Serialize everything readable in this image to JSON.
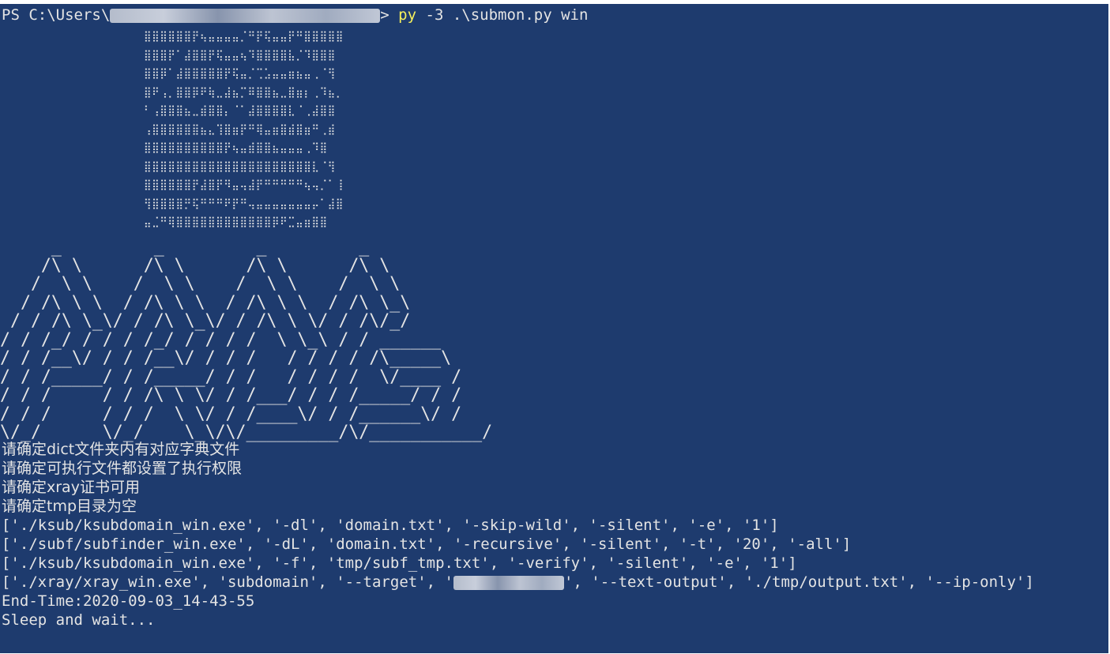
{
  "prompt": {
    "prefix": "PS C:\\Users\\",
    "suffix": "> ",
    "command_py": "py",
    "command_args": " -3 .\\submon.py win"
  },
  "braille_art": [
    "⣿⣿⣿⣿⣿⣿⡟⢦⣤⣤⣤⣤⡈⠛⡟⢯⣤⣤⡟⠛⣿⣿⣿⣿⣿",
    "⣿⣿⣿⡟⠁⣼⣿⣿⡟⢯⣤⣤⢦⠹⣿⣿⣿⣿⣧⡈⠹⣿⣿⣿",
    "⣿⣿⡿⠁⣼⣿⣿⣿⣿⣿⡟⢯⣤⡈⢉⣡⣤⣤⣶⣦⣤⢀⠈⢻",
    "⣿⠟⢠⡀⣿⣿⡿⠟⢷⣀⣼⣦⡉⠿⣿⣿⣦⣀⣿⣶⡆⢀⠹⣦⡀",
    "⠃⢠⣿⣿⣿⣦⣀⣾⣿⣿⡄⠈⠁⣼⣿⣿⣿⣿⣇⠈⢀⣼⣿⣿",
    "⢠⣿⣿⣿⣿⣿⣿⣦⣄⢹⣿⣶⡟⠛⢿⣤⣶⣿⣾⣿⣶⠛⢀⣾",
    "⣿⣿⣿⣿⣿⣿⣿⣿⣿⣿⡟⢦⣤⣾⣿⣿⣦⣤⣤⣤⢀⠹⣿",
    "⣿⣿⣿⣿⣿⣿⣿⣿⣿⣿⣿⣿⣿⣿⣿⣿⣿⣿⣿⣿⣿⣇⠈⢻",
    "⣿⣿⣿⣿⣿⣿⡟⣼⣿⡟⠻⣤⢤⣼⡟⠛⠛⠛⠛⠛⢦⢤⡈⠁⢸",
    "⢻⣿⣿⣿⣿⡛⢯⠛⠛⠛⠟⡟⠛⢤⣤⣤⣤⣤⣤⣤⣤⡤⠁⣼⣿",
    "⣤⣈⠛⢿⣿⣿⣿⣿⣿⣿⣿⣿⣿⣿⣿⣿⡿⠟⣉⣤⣶⣿⣿"
  ],
  "banner": [
    "     _         _         _         _",
    "    /\\ \\      /\\ \\      /\\ \\      /\\ \\",
    "   /  \\ \\    /  \\ \\    /  \\ \\    /  \\ \\",
    "  / /\\ \\ \\  / /\\ \\ \\  / /\\ \\ \\  / /\\ \\_\\",
    " / / /\\ \\_\\/ / /\\ \\_\\/ / /\\ \\ \\/ / /\\/_/",
    "/ / /_/ / / / /_/ / / / /  \\ \\_\\ / / ______",
    "/ / /__\\/ / / /__\\/ / / /   / / / / /\\_____\\",
    "/ / /_____/ / /_____/ / /   / / / /  \\/____ /",
    "/ / /     / / /\\ \\ \\/ / /___/ / / /_____/ / /",
    "/ / /     / / /  \\ \\/ / /____\\/ / /______\\/ /",
    "\\/_/      \\/_/    \\_\\/\\/_________/\\/___________/"
  ],
  "messages": [
    "请确定dict文件夹内有对应字典文件",
    "请确定可执行文件都设置了执行权限",
    "请确定xray证书可用",
    "请确定tmp目录为空"
  ],
  "commands": [
    "['./ksub/ksubdomain_win.exe', '-dl', 'domain.txt', '-skip-wild', '-silent', '-e', '1']",
    "['./subf/subfinder_win.exe', '-dL', 'domain.txt', '-recursive', '-silent', '-t', '20', '-all']",
    "['./ksub/ksubdomain_win.exe', '-f', 'tmp/subf_tmp.txt', '-verify', '-silent', '-e', '1']"
  ],
  "xray_command": {
    "before": "['./xray/xray_win.exe', 'subdomain', '--target', '",
    "after": "', '--text-output', './tmp/output.txt', '--ip-only']"
  },
  "end_time": "End-Time:2020-09-03_14-43-55",
  "status": "Sleep and wait...",
  "colors": {
    "background": "#1e3b6e",
    "text": "#e4e4e4",
    "command_highlight": "#f5f05c"
  }
}
